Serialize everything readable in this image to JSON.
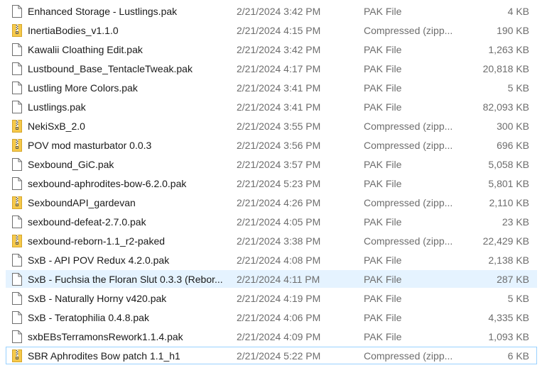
{
  "colors": {
    "selected_bg": "#e5f3ff",
    "focus_border": "#99d1ff",
    "zip_folder": "#f6c94a",
    "zip_zipper": "#5a5a5a",
    "meta_text": "#6d6d6d"
  },
  "files": [
    {
      "name": "Enhanced Storage - Lustlings.pak",
      "date": "2/21/2024 3:42 PM",
      "type": "PAK File",
      "size": "4 KB",
      "icon": "file-icon"
    },
    {
      "name": "InertiaBodies_v1.1.0",
      "date": "2/21/2024 4:15 PM",
      "type": "Compressed (zipp...",
      "size": "190 KB",
      "icon": "zip-folder-icon"
    },
    {
      "name": "Kawalii Cloathing Edit.pak",
      "date": "2/21/2024 3:42 PM",
      "type": "PAK File",
      "size": "1,263 KB",
      "icon": "file-icon"
    },
    {
      "name": "Lustbound_Base_TentacleTweak.pak",
      "date": "2/21/2024 4:17 PM",
      "type": "PAK File",
      "size": "20,818 KB",
      "icon": "file-icon"
    },
    {
      "name": "Lustling More Colors.pak",
      "date": "2/21/2024 3:41 PM",
      "type": "PAK File",
      "size": "5 KB",
      "icon": "file-icon"
    },
    {
      "name": "Lustlings.pak",
      "date": "2/21/2024 3:41 PM",
      "type": "PAK File",
      "size": "82,093 KB",
      "icon": "file-icon"
    },
    {
      "name": "NekiSxB_2.0",
      "date": "2/21/2024 3:55 PM",
      "type": "Compressed (zipp...",
      "size": "300 KB",
      "icon": "zip-folder-icon"
    },
    {
      "name": "POV mod masturbator 0.0.3",
      "date": "2/21/2024 3:56 PM",
      "type": "Compressed (zipp...",
      "size": "696 KB",
      "icon": "zip-folder-icon"
    },
    {
      "name": "Sexbound_GiC.pak",
      "date": "2/21/2024 3:57 PM",
      "type": "PAK File",
      "size": "5,058 KB",
      "icon": "file-icon"
    },
    {
      "name": "sexbound-aphrodites-bow-6.2.0.pak",
      "date": "2/21/2024 5:23 PM",
      "type": "PAK File",
      "size": "5,801 KB",
      "icon": "file-icon"
    },
    {
      "name": "SexboundAPI_gardevan",
      "date": "2/21/2024 4:26 PM",
      "type": "Compressed (zipp...",
      "size": "2,110 KB",
      "icon": "zip-folder-icon"
    },
    {
      "name": "sexbound-defeat-2.7.0.pak",
      "date": "2/21/2024 4:05 PM",
      "type": "PAK File",
      "size": "23 KB",
      "icon": "file-icon"
    },
    {
      "name": "sexbound-reborn-1.1_r2-paked",
      "date": "2/21/2024 3:38 PM",
      "type": "Compressed (zipp...",
      "size": "22,429 KB",
      "icon": "zip-folder-icon"
    },
    {
      "name": "SxB - API POV Redux 4.2.0.pak",
      "date": "2/21/2024 4:08 PM",
      "type": "PAK File",
      "size": "2,138 KB",
      "icon": "file-icon"
    },
    {
      "name": "SxB - Fuchsia the Floran Slut 0.3.3 (Rebor...",
      "date": "2/21/2024 4:11 PM",
      "type": "PAK File",
      "size": "287 KB",
      "icon": "file-icon",
      "selected": true
    },
    {
      "name": "SxB - Naturally Horny v420.pak",
      "date": "2/21/2024 4:19 PM",
      "type": "PAK File",
      "size": "5 KB",
      "icon": "file-icon"
    },
    {
      "name": "SxB - Teratophilia 0.4.8.pak",
      "date": "2/21/2024 4:06 PM",
      "type": "PAK File",
      "size": "4,335 KB",
      "icon": "file-icon"
    },
    {
      "name": "sxbEBsTerramonsRework1.1.4.pak",
      "date": "2/21/2024 4:09 PM",
      "type": "PAK File",
      "size": "1,093 KB",
      "icon": "file-icon"
    },
    {
      "name": "SBR Aphrodites Bow patch 1.1_h1",
      "date": "2/21/2024 5:22 PM",
      "type": "Compressed (zipp...",
      "size": "6 KB",
      "icon": "zip-folder-icon",
      "focused": true
    }
  ]
}
